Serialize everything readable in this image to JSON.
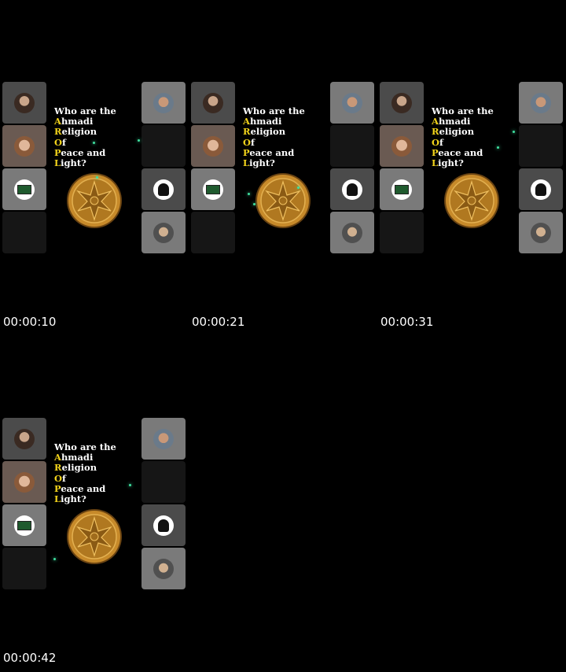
{
  "title": {
    "line1": "Who are the",
    "lines": [
      {
        "cap": "A",
        "rest": "hmadi"
      },
      {
        "cap": "R",
        "rest": "eligion"
      },
      {
        "cap": "O",
        "rest": "f"
      },
      {
        "cap": "P",
        "rest": "eace and"
      },
      {
        "cap": "L",
        "rest": "ight?"
      }
    ]
  },
  "frames": [
    {
      "timestamp": "00:00:10"
    },
    {
      "timestamp": "00:00:21"
    },
    {
      "timestamp": "00:00:31"
    },
    {
      "timestamp": "00:00:42"
    }
  ],
  "colors": {
    "background": "#000000",
    "accent": "#f2d31b",
    "sparkle": "#3fe0a0",
    "medal": "#b07820"
  }
}
